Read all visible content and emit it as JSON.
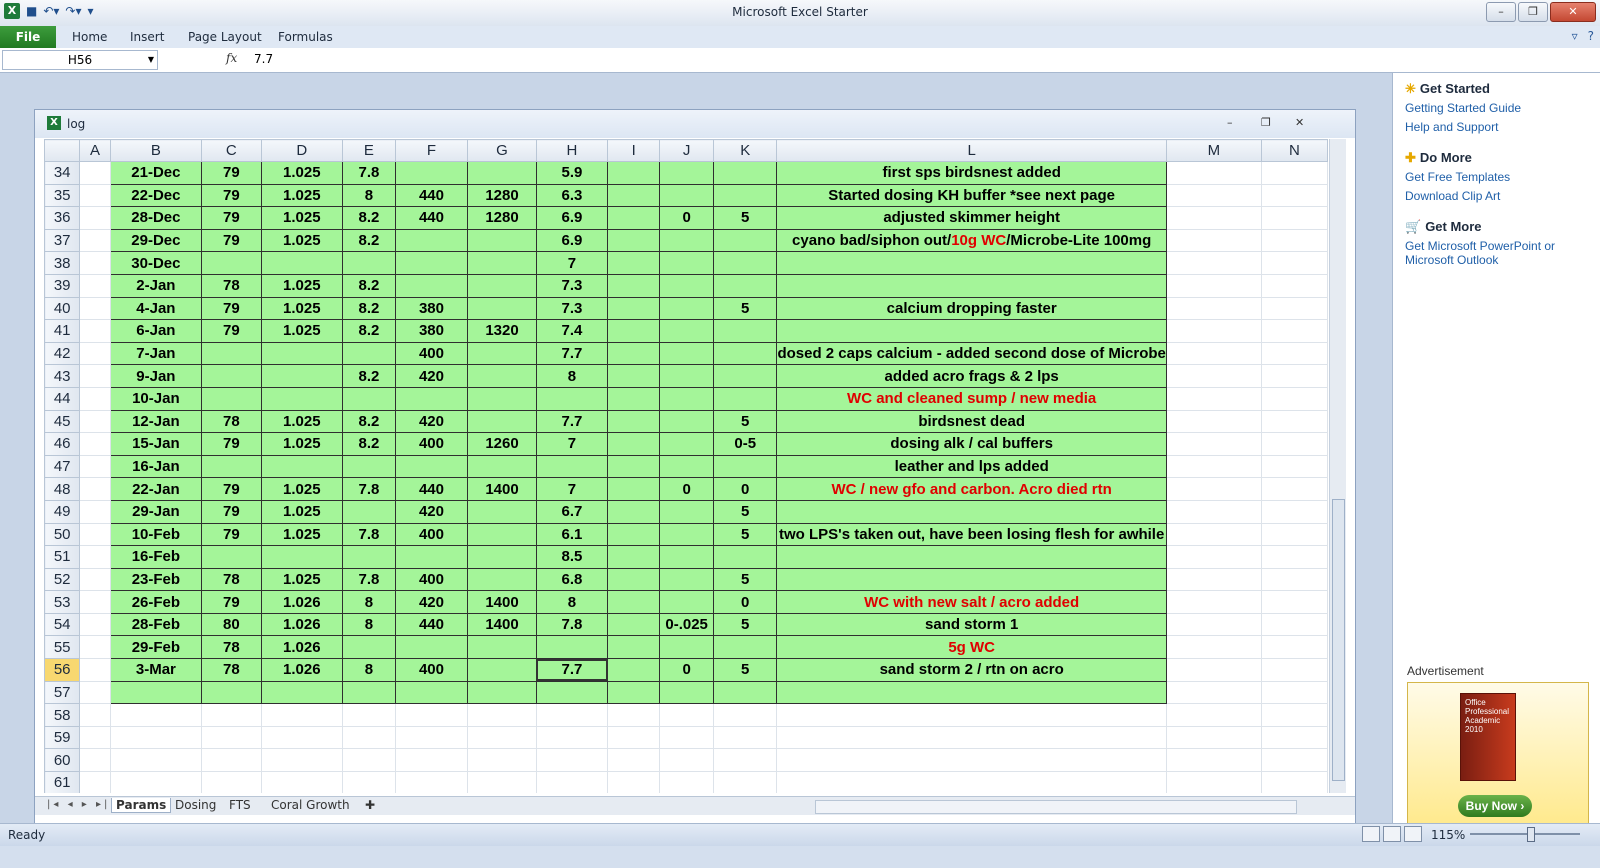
{
  "app": {
    "title": "Microsoft Excel Starter",
    "ribbon_tabs": [
      "File",
      "Home",
      "Insert",
      "Page Layout",
      "Formulas"
    ]
  },
  "formula_bar": {
    "name_box": "H56",
    "fx": "fx",
    "value": "7.7"
  },
  "workbook": {
    "title": "log",
    "columns": [
      "",
      "A",
      "B",
      "C",
      "D",
      "E",
      "F",
      "G",
      "H",
      "I",
      "J",
      "K",
      "L",
      "M",
      "N"
    ],
    "rows": [
      {
        "n": "34",
        "B": "21-Dec",
        "C": "79",
        "D": "1.025",
        "E": "7.8",
        "F": "",
        "G": "",
        "H": "5.9",
        "I": "",
        "J": "",
        "K": "",
        "L": "first sps birdsnest added",
        "red": false
      },
      {
        "n": "35",
        "B": "22-Dec",
        "C": "79",
        "D": "1.025",
        "E": "8",
        "F": "440",
        "G": "1280",
        "H": "6.3",
        "I": "",
        "J": "",
        "K": "",
        "L": "Started dosing KH buffer *see next page",
        "red": false
      },
      {
        "n": "36",
        "B": "28-Dec",
        "C": "79",
        "D": "1.025",
        "E": "8.2",
        "F": "440",
        "G": "1280",
        "H": "6.9",
        "I": "",
        "J": "0",
        "K": "5",
        "L": "adjusted skimmer height",
        "red": false
      },
      {
        "n": "37",
        "B": "29-Dec",
        "C": "79",
        "D": "1.025",
        "E": "8.2",
        "F": "",
        "G": "",
        "H": "6.9",
        "I": "",
        "J": "",
        "K": "",
        "L": "cyano bad/siphon out/10g WC/Microbe-Lite 100mg",
        "red": false
      },
      {
        "n": "38",
        "B": "30-Dec",
        "C": "",
        "D": "",
        "E": "",
        "F": "",
        "G": "",
        "H": "7",
        "I": "",
        "J": "",
        "K": "",
        "L": "",
        "red": false
      },
      {
        "n": "39",
        "B": "2-Jan",
        "C": "78",
        "D": "1.025",
        "E": "8.2",
        "F": "",
        "G": "",
        "H": "7.3",
        "I": "",
        "J": "",
        "K": "",
        "L": "",
        "red": false
      },
      {
        "n": "40",
        "B": "4-Jan",
        "C": "79",
        "D": "1.025",
        "E": "8.2",
        "F": "380",
        "G": "",
        "H": "7.3",
        "I": "",
        "J": "",
        "K": "5",
        "L": "calcium dropping faster",
        "red": false
      },
      {
        "n": "41",
        "B": "6-Jan",
        "C": "79",
        "D": "1.025",
        "E": "8.2",
        "F": "380",
        "G": "1320",
        "H": "7.4",
        "I": "",
        "J": "",
        "K": "",
        "L": "",
        "red": false
      },
      {
        "n": "42",
        "B": "7-Jan",
        "C": "",
        "D": "",
        "E": "",
        "F": "400",
        "G": "",
        "H": "7.7",
        "I": "",
        "J": "",
        "K": "",
        "L": "dosed 2 caps calcium - added second dose of Microbe",
        "red": false
      },
      {
        "n": "43",
        "B": "9-Jan",
        "C": "",
        "D": "",
        "E": "8.2",
        "F": "420",
        "G": "",
        "H": "8",
        "I": "",
        "J": "",
        "K": "",
        "L": "added acro frags & 2 lps",
        "red": false
      },
      {
        "n": "44",
        "B": "10-Jan",
        "C": "",
        "D": "",
        "E": "",
        "F": "",
        "G": "",
        "H": "",
        "I": "",
        "J": "",
        "K": "",
        "L": "WC and cleaned sump / new media",
        "red": true
      },
      {
        "n": "45",
        "B": "12-Jan",
        "C": "78",
        "D": "1.025",
        "E": "8.2",
        "F": "420",
        "G": "",
        "H": "7.7",
        "I": "",
        "J": "",
        "K": "5",
        "L": "birdsnest dead",
        "red": false
      },
      {
        "n": "46",
        "B": "15-Jan",
        "C": "79",
        "D": "1.025",
        "E": "8.2",
        "F": "400",
        "G": "1260",
        "H": "7",
        "I": "",
        "J": "",
        "K": "0-5",
        "L": "dosing alk / cal buffers",
        "red": false
      },
      {
        "n": "47",
        "B": "16-Jan",
        "C": "",
        "D": "",
        "E": "",
        "F": "",
        "G": "",
        "H": "",
        "I": "",
        "J": "",
        "K": "",
        "L": "leather and lps added",
        "red": false
      },
      {
        "n": "48",
        "B": "22-Jan",
        "C": "79",
        "D": "1.025",
        "E": "7.8",
        "F": "440",
        "G": "1400",
        "H": "7",
        "I": "",
        "J": "0",
        "K": "0",
        "L": "WC  / new gfo and carbon. Acro died rtn",
        "red": true
      },
      {
        "n": "49",
        "B": "29-Jan",
        "C": "79",
        "D": "1.025",
        "E": "",
        "F": "420",
        "G": "",
        "H": "6.7",
        "I": "",
        "J": "",
        "K": "5",
        "L": "",
        "red": false
      },
      {
        "n": "50",
        "B": "10-Feb",
        "C": "79",
        "D": "1.025",
        "E": "7.8",
        "F": "400",
        "G": "",
        "H": "6.1",
        "I": "",
        "J": "",
        "K": "5",
        "L": "two LPS's taken out, have been losing flesh for awhile",
        "red": false
      },
      {
        "n": "51",
        "B": "16-Feb",
        "C": "",
        "D": "",
        "E": "",
        "F": "",
        "G": "",
        "H": "8.5",
        "I": "",
        "J": "",
        "K": "",
        "L": "",
        "red": false
      },
      {
        "n": "52",
        "B": "23-Feb",
        "C": "78",
        "D": "1.025",
        "E": "7.8",
        "F": "400",
        "G": "",
        "H": "6.8",
        "I": "",
        "J": "",
        "K": "5",
        "L": "",
        "red": false
      },
      {
        "n": "53",
        "B": "26-Feb",
        "C": "79",
        "D": "1.026",
        "E": "8",
        "F": "420",
        "G": "1400",
        "H": "8",
        "I": "",
        "J": "",
        "K": "0",
        "L": "WC with new salt / acro added",
        "red": true
      },
      {
        "n": "54",
        "B": "28-Feb",
        "C": "80",
        "D": "1.026",
        "E": "8",
        "F": "440",
        "G": "1400",
        "H": "7.8",
        "I": "",
        "J": "0-.025",
        "K": "5",
        "L": "sand storm 1",
        "red": false
      },
      {
        "n": "55",
        "B": "29-Feb",
        "C": "78",
        "D": "1.026",
        "E": "",
        "F": "",
        "G": "",
        "H": "",
        "I": "",
        "J": "",
        "K": "",
        "L": "5g WC",
        "red": true
      },
      {
        "n": "56",
        "B": "3-Mar",
        "C": "78",
        "D": "1.026",
        "E": "8",
        "F": "400",
        "G": "",
        "H": "7.7",
        "I": "",
        "J": "0",
        "K": "5",
        "L": "sand storm 2 / rtn on acro",
        "red": false
      },
      {
        "n": "57",
        "B": "",
        "C": "",
        "D": "",
        "E": "",
        "F": "",
        "G": "",
        "H": "",
        "I": "",
        "J": "",
        "K": "",
        "L": "",
        "red": false
      }
    ],
    "blank_rows": [
      "58",
      "59",
      "60",
      "61"
    ],
    "sheet_tabs": [
      "Params",
      "Dosing",
      "FTS",
      "Coral Growth"
    ]
  },
  "status": {
    "ready": "Ready",
    "zoom": "115%"
  },
  "task_pane": {
    "get_started": "Get Started",
    "getting_started_guide": "Getting Started Guide",
    "help_support": "Help and Support",
    "do_more": "Do More",
    "free_templates": "Get Free Templates",
    "clip_art": "Download Clip Art",
    "get_more": "Get More",
    "get_more_link": "Get Microsoft PowerPoint or Microsoft Outlook",
    "advertisement": "Advertisement",
    "ad_box_text": "Office Professional Academic 2010",
    "buy_now": "Buy Now ›"
  },
  "colors": {
    "cell_green": "#a4f599",
    "red_text": "#e00000",
    "selected_header": "#f8d870"
  }
}
